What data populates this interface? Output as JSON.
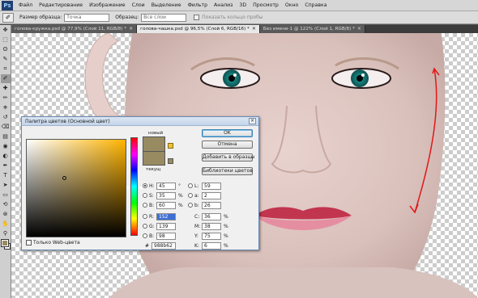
{
  "menubar": {
    "logo": "Ps",
    "items": [
      "Файл",
      "Редактирование",
      "Изображение",
      "Слои",
      "Выделение",
      "Фильтр",
      "Анализ",
      "3D",
      "Просмотр",
      "Окно",
      "Справка"
    ]
  },
  "options": {
    "sample_size_label": "Размер образца:",
    "sample_size_value": "Точка",
    "sample_label": "Образец:",
    "sample_value": "Все слои",
    "show_ring_label": "Показать кольцо пробы"
  },
  "tabs": [
    {
      "label": "голова-кружка.psd @ 77,9% (Слой 11, RGB/8) *"
    },
    {
      "label": "голова-чашка.psd @ 96,5% (Слой 6, RGB/16) *"
    },
    {
      "label": "Без имени-1 @ 122% (Слой 1, RGB/8) *"
    }
  ],
  "tab_close": "×",
  "toolbox": {
    "icons": [
      "move-icon",
      "marquee-icon",
      "lasso-icon",
      "quick-select-icon",
      "crop-icon",
      "eyedropper-icon",
      "healing-icon",
      "brush-icon",
      "clone-stamp-icon",
      "history-brush-icon",
      "eraser-icon",
      "gradient-icon",
      "blur-icon",
      "dodge-icon",
      "pen-icon",
      "type-icon",
      "path-select-icon",
      "shape-icon",
      "3d-rotate-icon",
      "3d-orbit-icon",
      "hand-icon",
      "zoom-icon"
    ],
    "glyphs": [
      "✥",
      "⬚",
      "ʘ",
      "✎",
      "⌗",
      "✐",
      "✚",
      "✏",
      "⎈",
      "↺",
      "⌫",
      "▤",
      "◉",
      "◐",
      "✒",
      "T",
      "➤",
      "▭",
      "⟲",
      "⊛",
      "✋",
      "⚲"
    ],
    "fg_color": "#988b62",
    "bg_color": "#ffffff"
  },
  "dialog": {
    "title": "Палитра цветов (Основной цвет)",
    "close": "×",
    "new_label": "новый",
    "current_label": "текущ",
    "ok": "OK",
    "cancel": "Отмена",
    "add_swatches": "Добавить в образцы",
    "libraries": "Библиотеки цветов",
    "web_only": "Только Web-цвета",
    "color_hex": "#988b62",
    "field_hue_color": "#ffb400",
    "fields": {
      "H": {
        "label": "H:",
        "value": "45",
        "unit": "°"
      },
      "S": {
        "label": "S:",
        "value": "35",
        "unit": "%"
      },
      "B": {
        "label": "B:",
        "value": "60",
        "unit": "%"
      },
      "R": {
        "label": "R:",
        "value": "152",
        "unit": ""
      },
      "G": {
        "label": "G:",
        "value": "139",
        "unit": ""
      },
      "Bl": {
        "label": "B:",
        "value": "98",
        "unit": ""
      },
      "L": {
        "label": "L:",
        "value": "59",
        "unit": ""
      },
      "a": {
        "label": "a:",
        "value": "2",
        "unit": ""
      },
      "b": {
        "label": "b:",
        "value": "26",
        "unit": ""
      },
      "C": {
        "label": "C:",
        "value": "36",
        "unit": "%"
      },
      "M": {
        "label": "M:",
        "value": "38",
        "unit": "%"
      },
      "Y": {
        "label": "Y:",
        "value": "75",
        "unit": "%"
      },
      "K": {
        "label": "K:",
        "value": "6",
        "unit": "%"
      }
    },
    "hex_label": "#",
    "hex_value": "988b62"
  }
}
